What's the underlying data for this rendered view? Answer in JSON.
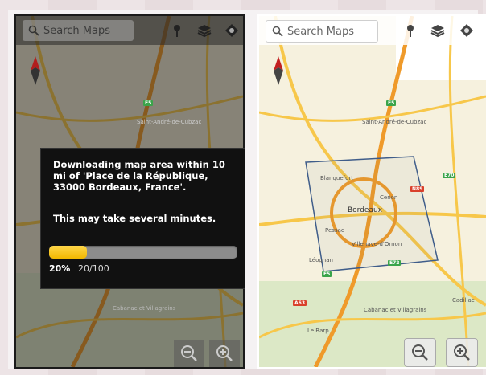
{
  "left_screen": {
    "search_placeholder": "Search Maps",
    "dialog": {
      "message": "Downloading map area within 10 mi of 'Place de la République, 33000 Bordeaux, France'.",
      "warning": "This may take several minutes.",
      "progress_fraction": 0.2,
      "percent_label": "20%",
      "count_label": "20/100"
    },
    "map_labels": [
      "Saint-André-de-Cubzac",
      "Cabanac et Villagrains"
    ],
    "road_shields": [
      "E5"
    ]
  },
  "right_screen": {
    "search_placeholder": "Search Maps",
    "map_labels": {
      "place_1": "Saint-André-de-Cubzac",
      "place_2": "Blanquefort",
      "place_3": "Bordeaux",
      "place_4": "Cenon",
      "place_5": "Pessac",
      "place_6": "Villenave-d'Ornon",
      "place_7": "Léognan",
      "place_8": "Cadillac",
      "place_9": "Le Barp",
      "place_10": "Cabanac et Villagrains"
    },
    "road_shields": {
      "green": [
        "E5",
        "E70",
        "E72",
        "E5"
      ],
      "red": [
        "N89",
        "A63"
      ]
    }
  },
  "icons": [
    "search-icon",
    "pin-icon",
    "layers-icon",
    "my-location-icon",
    "compass-icon",
    "zoom-out-icon",
    "zoom-in-icon"
  ],
  "colors": {
    "progress_fill": "#f2b800",
    "dialog_bg": "#111111",
    "road_yellow": "#f7c74a",
    "road_orange": "#ef9a2a",
    "download_box": "#3f5d8a"
  }
}
